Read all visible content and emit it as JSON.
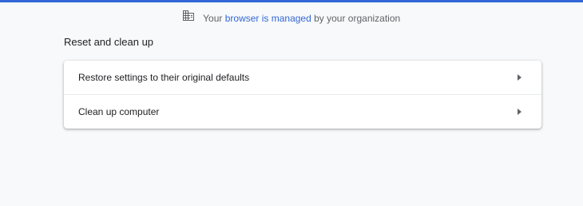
{
  "notice": {
    "prefix": "Your",
    "link": "browser is managed",
    "suffix": "by your organization"
  },
  "section": {
    "title": "Reset and clean up"
  },
  "rows": [
    {
      "label": "Restore settings to their original defaults"
    },
    {
      "label": "Clean up computer"
    }
  ],
  "colors": {
    "accent": "#3367d6",
    "background": "#f8f9fa",
    "text": "#202124",
    "secondary_text": "#5f6368"
  },
  "icons": {
    "notice": "building-icon",
    "row_arrow": "arrow-right-icon"
  }
}
